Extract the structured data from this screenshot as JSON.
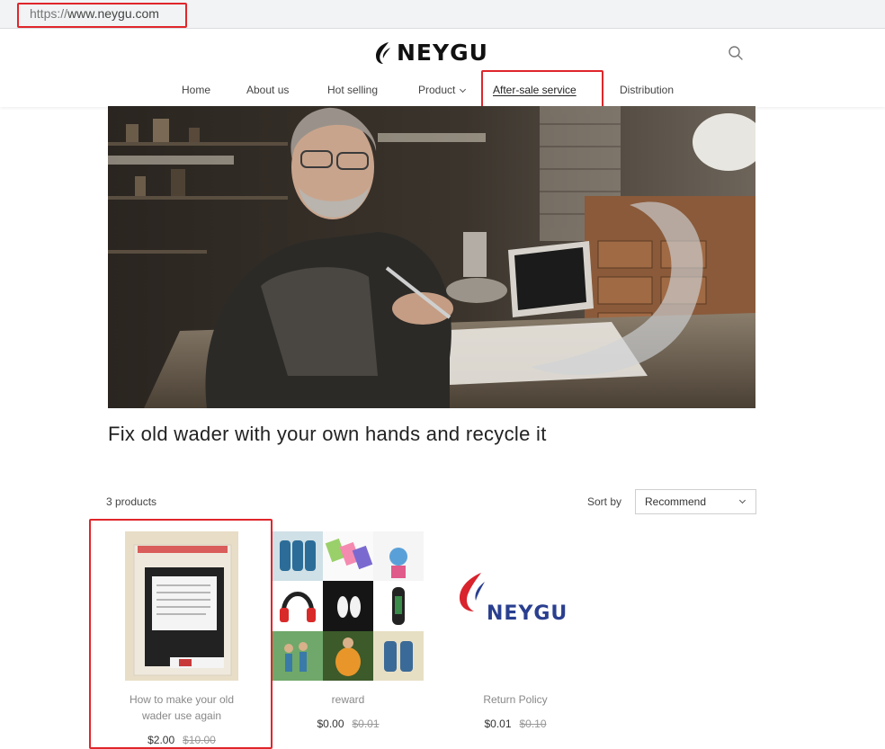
{
  "browser": {
    "url_scheme": "https://",
    "url_host": "www.neygu.com"
  },
  "header": {
    "brand": "NEYGU",
    "nav": [
      {
        "label": "Home"
      },
      {
        "label": "About us"
      },
      {
        "label": "Hot selling"
      },
      {
        "label": "Product"
      },
      {
        "label": "After-sale service"
      },
      {
        "label": "Distribution"
      }
    ]
  },
  "collection": {
    "title": "Fix old wader with your own hands and recycle it",
    "count_text": "3 products",
    "sort_label": "Sort by",
    "sort_value": "Recommend"
  },
  "products": [
    {
      "name": "How to make your old wader use again",
      "price": "$2.00",
      "compare_price": "$10.00"
    },
    {
      "name": "reward",
      "price": "$0.00",
      "compare_price": "$0.01"
    },
    {
      "name": "Return Policy",
      "price": "$0.01",
      "compare_price": "$0.10"
    }
  ],
  "colors": {
    "annotation_red": "#e0262b",
    "logo_red": "#d9232d",
    "logo_blue": "#2a3f8f"
  }
}
